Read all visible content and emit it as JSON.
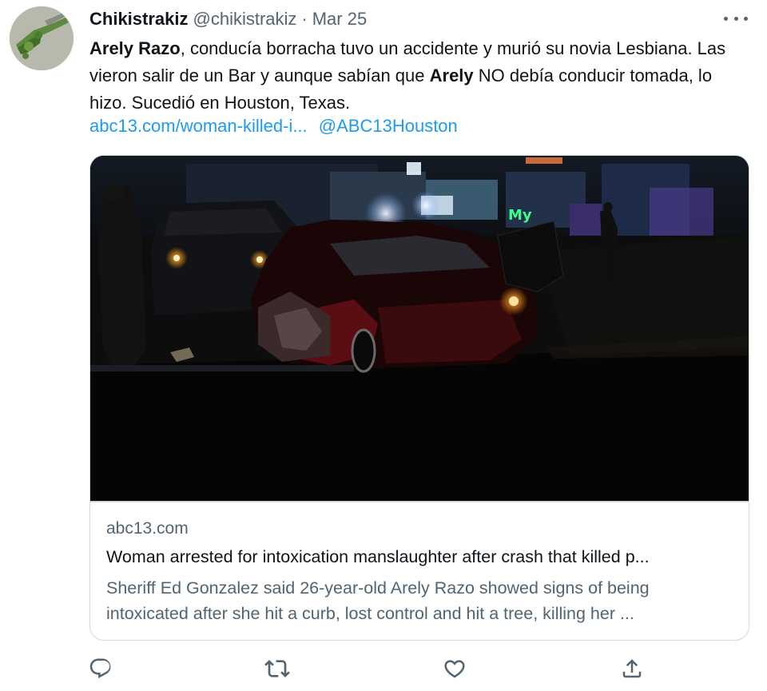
{
  "author": {
    "name": "Chikistrakiz",
    "handle": "@chikistrakiz",
    "separator": "·",
    "date": "Mar 25",
    "avatar_icon": "avatar-image"
  },
  "more_icon": "more-options-icon",
  "tweet": {
    "segments": [
      {
        "text": "Arely Razo",
        "bold": true
      },
      {
        "text": ", conducía borracha tuvo un accidente y murió su novia Lesbiana. Las vieron salir de un Bar y aunque sabían que ",
        "bold": false
      },
      {
        "text": "Arely",
        "bold": true
      },
      {
        "text": " NO debía conducir tomada, lo hizo. Sucedió en Houston, Texas.",
        "bold": false
      }
    ],
    "link_url_text": "abc13.com/woman-killed-i...",
    "mention_text": "@ABC13Houston"
  },
  "card": {
    "image_alt": "Night scene of a crashed red car",
    "domain": "abc13.com",
    "title": "Woman arrested for intoxication manslaughter after crash that killed p...",
    "description": "Sheriff Ed Gonzalez said 26-year-old Arely Razo showed signs of being intoxicated after she hit a curb, lost control and hit a tree, killing her ..."
  },
  "actions": [
    {
      "name": "reply-icon"
    },
    {
      "name": "retweet-icon"
    },
    {
      "name": "like-icon"
    },
    {
      "name": "share-icon"
    }
  ],
  "colors": {
    "text": "#0f1419",
    "secondary": "#536471",
    "link": "#1d9bf0",
    "border": "#cfd9de"
  }
}
